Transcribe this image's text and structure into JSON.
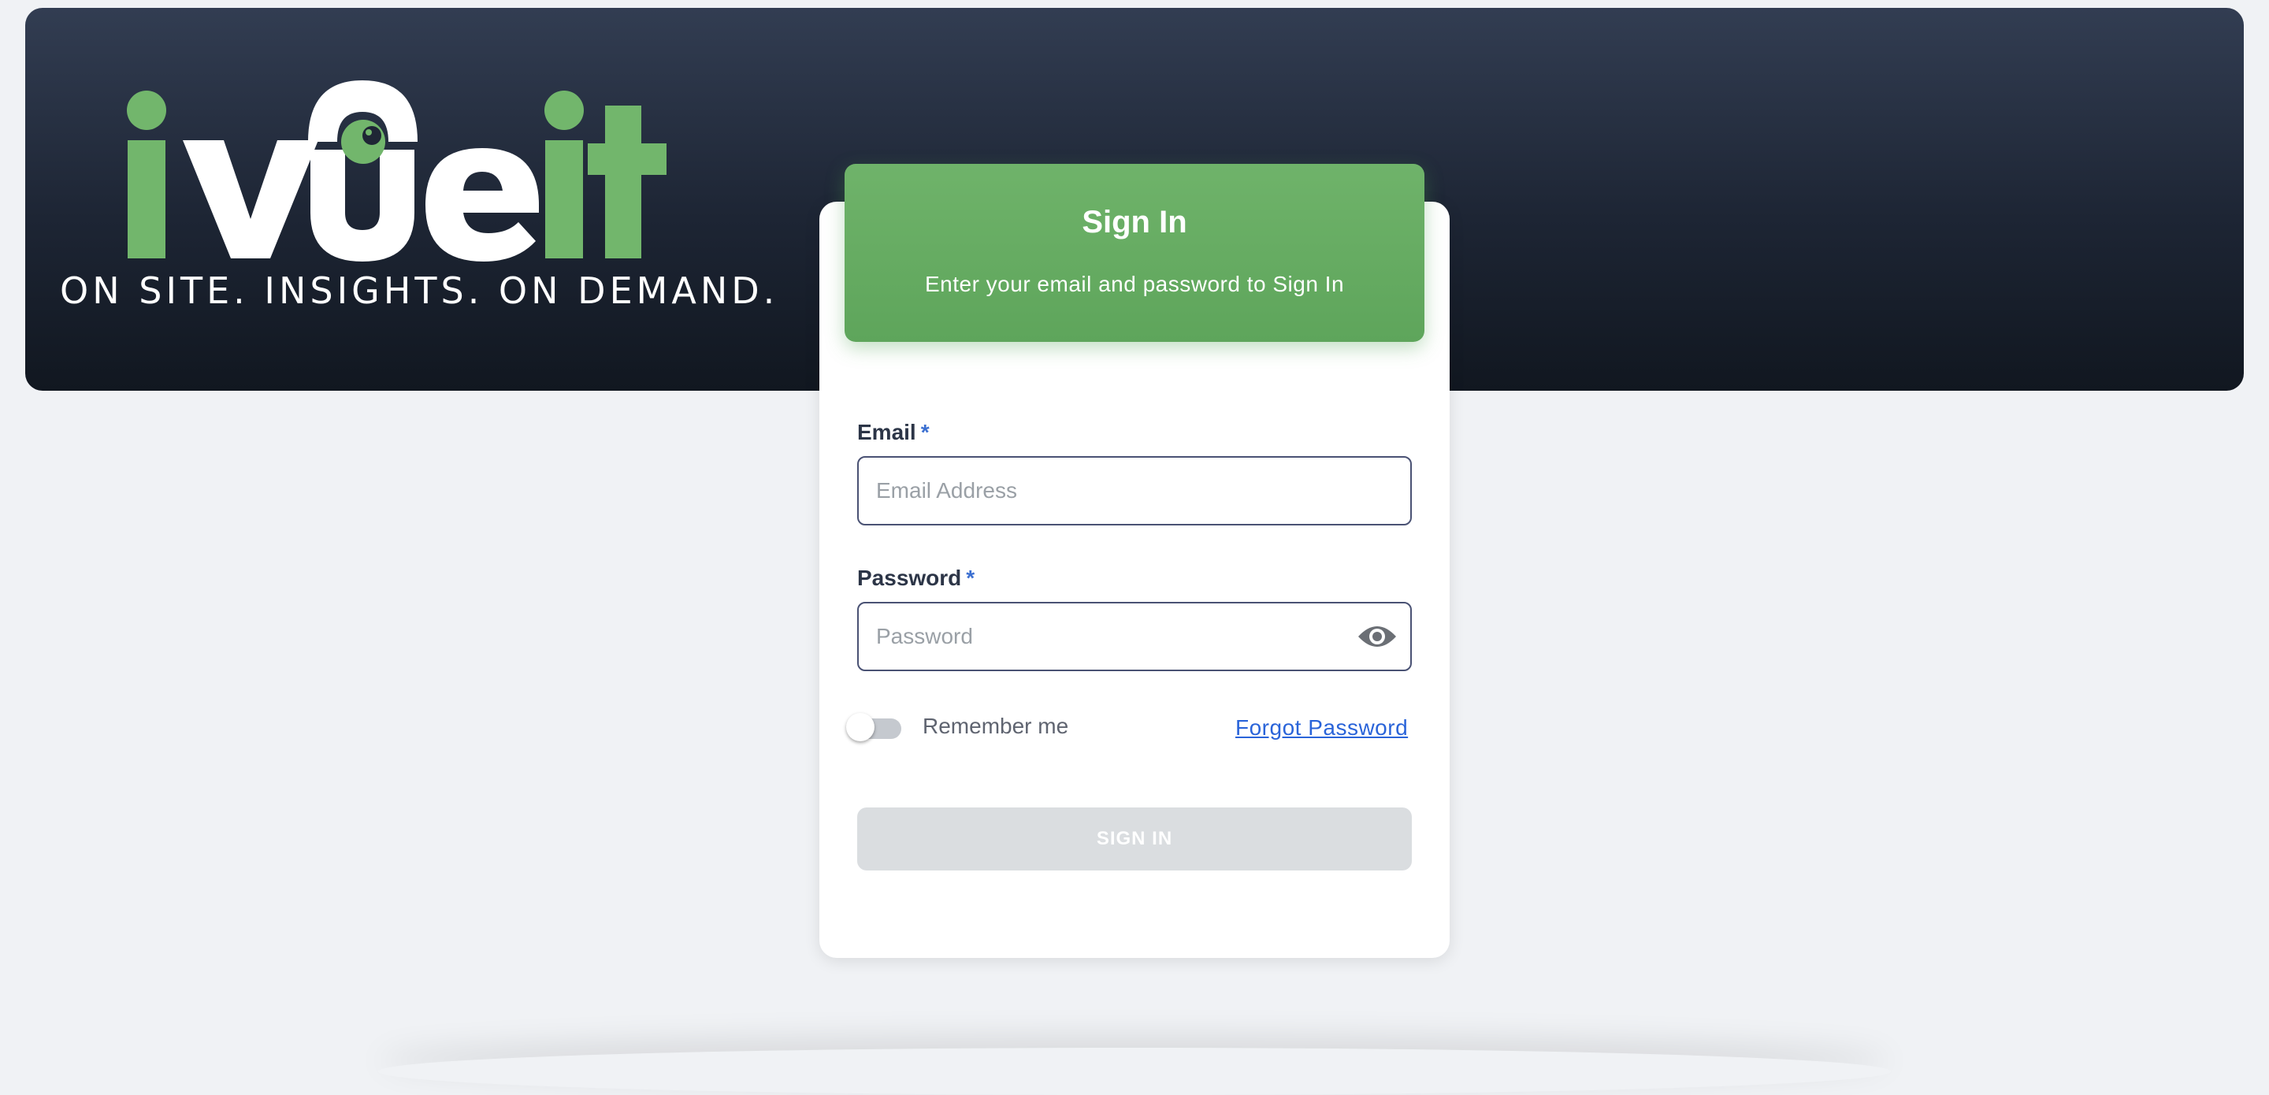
{
  "brand": {
    "logo_text": "ivueit",
    "tagline": "ON SITE. INSIGHTS. ON DEMAND.",
    "green": "#72b66c",
    "white": "#ffffff"
  },
  "signin_header": {
    "title": "Sign In",
    "subtitle": "Enter your email and password to Sign In"
  },
  "form": {
    "email": {
      "label": "Email",
      "required_mark": "*",
      "placeholder": "Email Address",
      "value": ""
    },
    "password": {
      "label": "Password",
      "required_mark": "*",
      "placeholder": "Password",
      "value": "",
      "toggle_icon": "eye-icon"
    },
    "remember_me": {
      "label": "Remember me",
      "checked": false
    },
    "forgot_password": "Forgot Password",
    "submit_label": "SIGN IN",
    "submit_enabled": false
  },
  "colors": {
    "header_gradient_top": "#323d52",
    "header_gradient_bottom": "#111720",
    "accent_green": "#6aae66",
    "link_blue": "#2a64d9",
    "required_blue": "#3b6fd1",
    "disabled_button": "#dadde0",
    "page_background": "#f0f2f5"
  }
}
